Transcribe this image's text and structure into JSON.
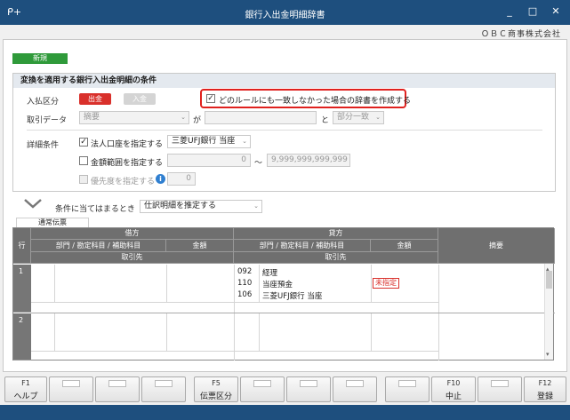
{
  "window": {
    "title": "銀行入出金明細辞書",
    "app_icon": "ᑭ+",
    "minimize": "_",
    "maximize": "□",
    "close": "✕"
  },
  "company": "ＯＢＣ商事株式会社",
  "new_button": "新規",
  "conditions": {
    "section_title": "変換を適用する銀行入出金明細の条件",
    "direction_label": "入払区分",
    "withdrawal": "出金",
    "deposit": "入金",
    "create_dict_checkbox": "どのルールにも一致しなかった場合の辞書を作成する",
    "data_label": "取引データ",
    "data_select": "摘要",
    "ga": "が",
    "to": "と",
    "match_select": "部分一致",
    "detail_label": "詳細条件",
    "corp_account_checkbox": "法人口座を指定する",
    "account_select": "三菱UFJ銀行 当座",
    "amount_checkbox": "金額範囲を指定する",
    "amount_from": "0",
    "tilde": "〜",
    "amount_to": "9,999,999,999,999",
    "priority_checkbox": "優先度を指定する",
    "priority_value": "0",
    "info_icon": "i"
  },
  "when_match": {
    "label": "条件に当てはまるとき",
    "select": "仕訳明細を推定する"
  },
  "tab_normal": "通常伝票",
  "grid": {
    "row_header": "行",
    "debit": "借方",
    "credit": "貸方",
    "account_col": "部門 / 勘定科目 / 補助科目",
    "amount_col": "金額",
    "partner_col": "取引先",
    "memo_col": "摘要",
    "rows": [
      {
        "num": "1",
        "credit_lines": [
          {
            "code": "092",
            "name": "経理"
          },
          {
            "code": "110",
            "name": "当座預金"
          },
          {
            "code": "106",
            "name": "三菱UFJ銀行 当座"
          }
        ],
        "badge": "未指定"
      },
      {
        "num": "2"
      }
    ]
  },
  "fkeys": [
    {
      "num": "F1",
      "name": "ヘルプ"
    },
    {
      "num": "",
      "name": ""
    },
    {
      "num": "",
      "name": ""
    },
    {
      "num": "",
      "name": ""
    },
    {
      "num": "F5",
      "name": "伝票区分"
    },
    {
      "num": "",
      "name": ""
    },
    {
      "num": "",
      "name": ""
    },
    {
      "num": "",
      "name": ""
    },
    {
      "num": "",
      "name": ""
    },
    {
      "num": "F10",
      "name": "中止"
    },
    {
      "num": "",
      "name": ""
    },
    {
      "num": "F12",
      "name": "登録"
    }
  ]
}
